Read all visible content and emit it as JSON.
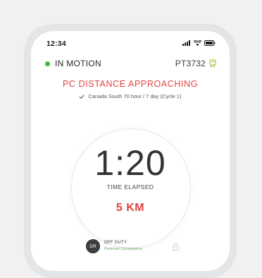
{
  "status_bar": {
    "time": "12:34"
  },
  "motion": {
    "label": "IN MOTION",
    "vehicle_id": "PT3732"
  },
  "alert": {
    "text": "PC DISTANCE APPROACHING"
  },
  "cycle": {
    "text": "Canada South 70 hour / 7 day (Cycle 1)"
  },
  "timer": {
    "value": "1:20",
    "label": "TIME ELAPSED",
    "distance": "5 KM"
  },
  "duty": {
    "avatar": "DR",
    "status": "OFF DUTY",
    "sub": "Personal Conveyance"
  },
  "colors": {
    "accent_red": "#e0433f",
    "status_green": "#43b649",
    "sub_green": "#5aa64f"
  },
  "icons": [
    "signal-icon",
    "wifi-icon",
    "battery-icon",
    "truck-icon",
    "check-icon",
    "lock-icon"
  ]
}
